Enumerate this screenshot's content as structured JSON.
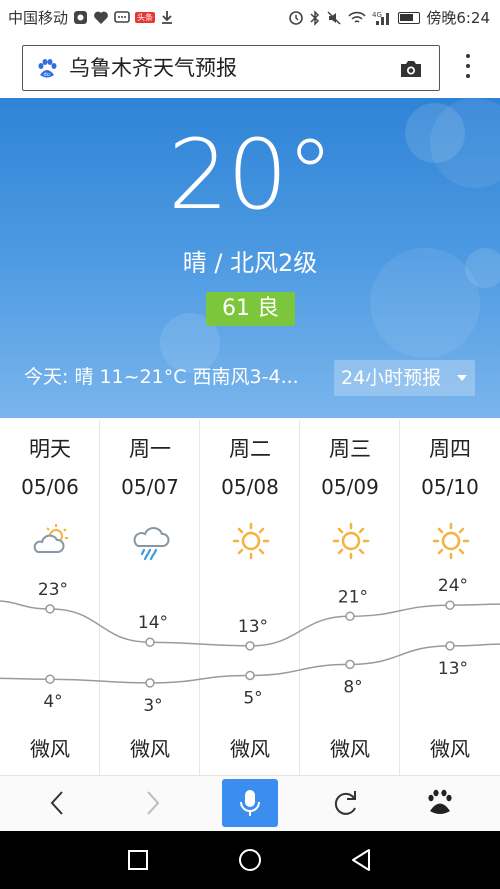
{
  "status_bar": {
    "carrier": "中国移动",
    "badge": "头条",
    "time_label": "傍晚6:24"
  },
  "browser": {
    "search_query": "乌鲁木齐天气预报",
    "search_logo_icon": "baidu-paw-icon",
    "camera_icon": "camera-icon",
    "menu_icon": "more-vert-icon"
  },
  "current": {
    "temperature": "20°",
    "condition": "晴  /  北风2级",
    "aqi": "61 良",
    "aqi_color": "#7bc63a",
    "today_summary": "今天:  晴   11~21°C   西南风3-4...",
    "hourly_button": "24小时预报"
  },
  "forecast": {
    "days": [
      {
        "day": "明天",
        "date": "05/06",
        "icon": "partly-cloudy-icon",
        "high": 23,
        "low": 4,
        "high_label": "23°",
        "low_label": "4°",
        "wind": "微风"
      },
      {
        "day": "周一",
        "date": "05/07",
        "icon": "rain-icon",
        "high": 14,
        "low": 3,
        "high_label": "14°",
        "low_label": "3°",
        "wind": "微风"
      },
      {
        "day": "周二",
        "date": "05/08",
        "icon": "sunny-icon",
        "high": 13,
        "low": 5,
        "high_label": "13°",
        "low_label": "5°",
        "wind": "微风"
      },
      {
        "day": "周三",
        "date": "05/09",
        "icon": "sunny-icon",
        "high": 21,
        "low": 8,
        "high_label": "21°",
        "low_label": "8°",
        "wind": "微风"
      },
      {
        "day": "周四",
        "date": "05/10",
        "icon": "sunny-icon",
        "high": 24,
        "low": 13,
        "high_label": "24°",
        "low_label": "13°",
        "wind": "微风"
      }
    ]
  },
  "toolbar": {
    "back_icon": "chevron-left-icon",
    "forward_icon": "chevron-right-icon",
    "voice_icon": "microphone-icon",
    "refresh_icon": "refresh-icon",
    "home_icon": "baidu-paw-icon",
    "voice_color": "#3b8ef0"
  },
  "nav_bar": {
    "back_icon": "triangle-back-icon",
    "home_icon": "circle-home-icon",
    "recents_icon": "square-recents-icon"
  }
}
